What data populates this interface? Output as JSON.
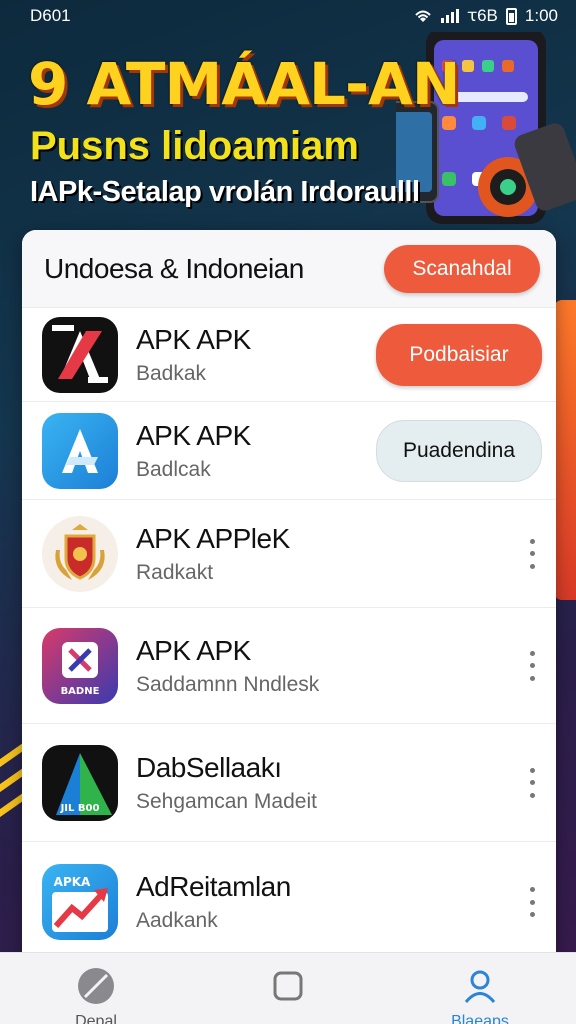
{
  "status_bar": {
    "left_text": "D601",
    "carrier": "ꚍ6B",
    "time": "1:00"
  },
  "banner": {
    "title": "9 ATMÁAL-AN",
    "subtitle": "Pusns lidoamiam",
    "tagline": "IAPk-Setalap vrolán Irdoraulll"
  },
  "card": {
    "title": "Undoesa & Indoneian",
    "header_button": "Scanahdal"
  },
  "apps": [
    {
      "name": "APK APK",
      "subtitle": "Badkak",
      "action": "Podbaisiar",
      "action_style": "orange",
      "icon": "black-x-app-icon"
    },
    {
      "name": "APK APK",
      "subtitle": "Badlcak",
      "action": "Puadendina",
      "action_style": "grey",
      "icon": "blue-a-app-icon"
    },
    {
      "name": "APK APPleK",
      "subtitle": "Radkakt",
      "action": "",
      "action_style": "more",
      "icon": "shield-crest-app-icon"
    },
    {
      "name": "APK APK",
      "subtitle": "Saddamnn Nndlesk",
      "action": "",
      "action_style": "more",
      "icon": "gradient-badge-app-icon",
      "icon_text": "BADNE"
    },
    {
      "name": "DabSellaakı",
      "subtitle": "Sehgamcan Madeit",
      "action": "",
      "action_style": "more",
      "icon": "green-triangle-app-icon",
      "icon_text": "JIL B00"
    },
    {
      "name": "AdReitamlan",
      "subtitle": "Aadkank",
      "action": "",
      "action_style": "more",
      "icon": "chart-arrow-app-icon",
      "icon_text": "APKA"
    }
  ],
  "bottom_nav": [
    {
      "label": "Depal",
      "icon": "compass-icon",
      "active": false
    },
    {
      "label": "",
      "icon": "square-icon",
      "active": false
    },
    {
      "label": "Blaeaps",
      "icon": "profile-icon",
      "active": true
    }
  ],
  "colors": {
    "accent_orange": "#ee5a3c",
    "accent_blue": "#2a84d8",
    "banner_yellow": "#ffd21f"
  }
}
